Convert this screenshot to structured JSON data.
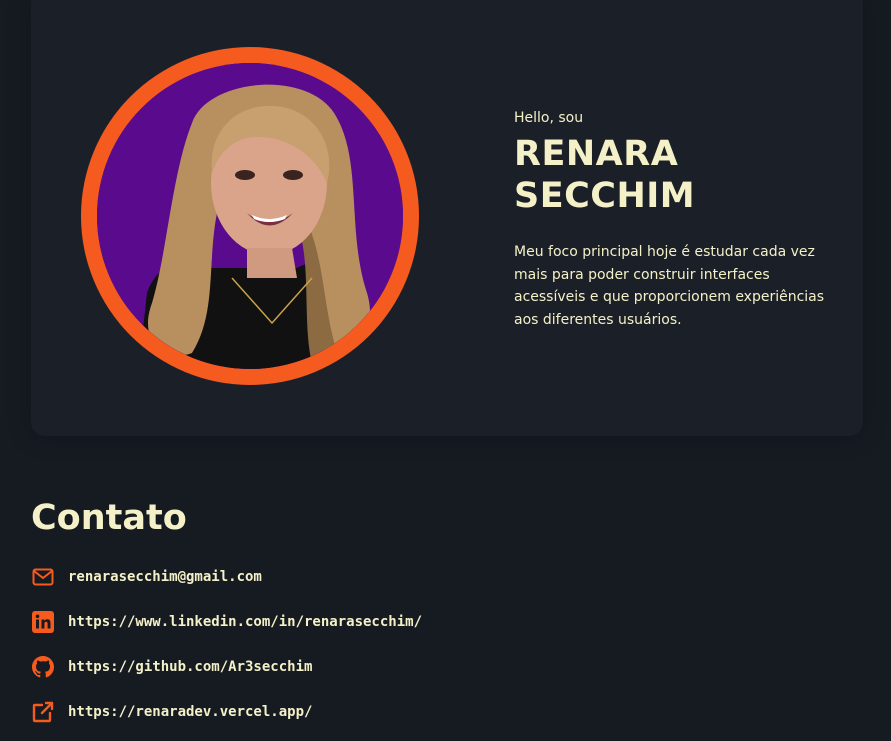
{
  "hero": {
    "greeting": "Hello, sou",
    "name_line1": "RENARA",
    "name_line2": "SECCHIM",
    "bio": "Meu foco principal hoje é estudar cada vez mais para poder construir interfaces acessíveis e que proporcionem experiências aos diferentes usuários.",
    "avatar_icon": "profile-photo"
  },
  "contact": {
    "title": "Contato",
    "items": [
      {
        "icon": "mail-icon",
        "text": "renarasecchim@gmail.com"
      },
      {
        "icon": "linkedin-icon",
        "text": "https://www.linkedin.com/in/renarasecchim/"
      },
      {
        "icon": "github-icon",
        "text": "https://github.com/Ar3secchim"
      },
      {
        "icon": "external-link-icon",
        "text": "https://renaradev.vercel.app/"
      }
    ]
  },
  "colors": {
    "background": "#161b22",
    "card": "#1b2028",
    "accent": "#f55a1e",
    "text": "#f4f1c8",
    "avatar_bg": "#5a0a8c"
  }
}
